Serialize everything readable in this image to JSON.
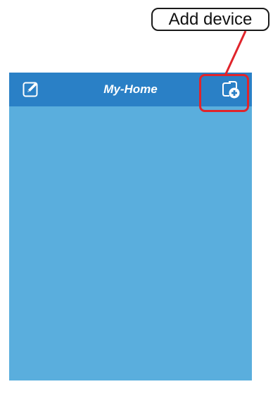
{
  "annotation": {
    "callout_label": "Add device",
    "highlight_color": "#e0242b"
  },
  "nav_bar": {
    "title": "My-Home",
    "left_icon": "edit-icon",
    "right_icon": "add-device-icon"
  },
  "colors": {
    "nav_bar": "#2a80c6",
    "content_background": "#5aaedd",
    "icon": "#ffffff"
  }
}
